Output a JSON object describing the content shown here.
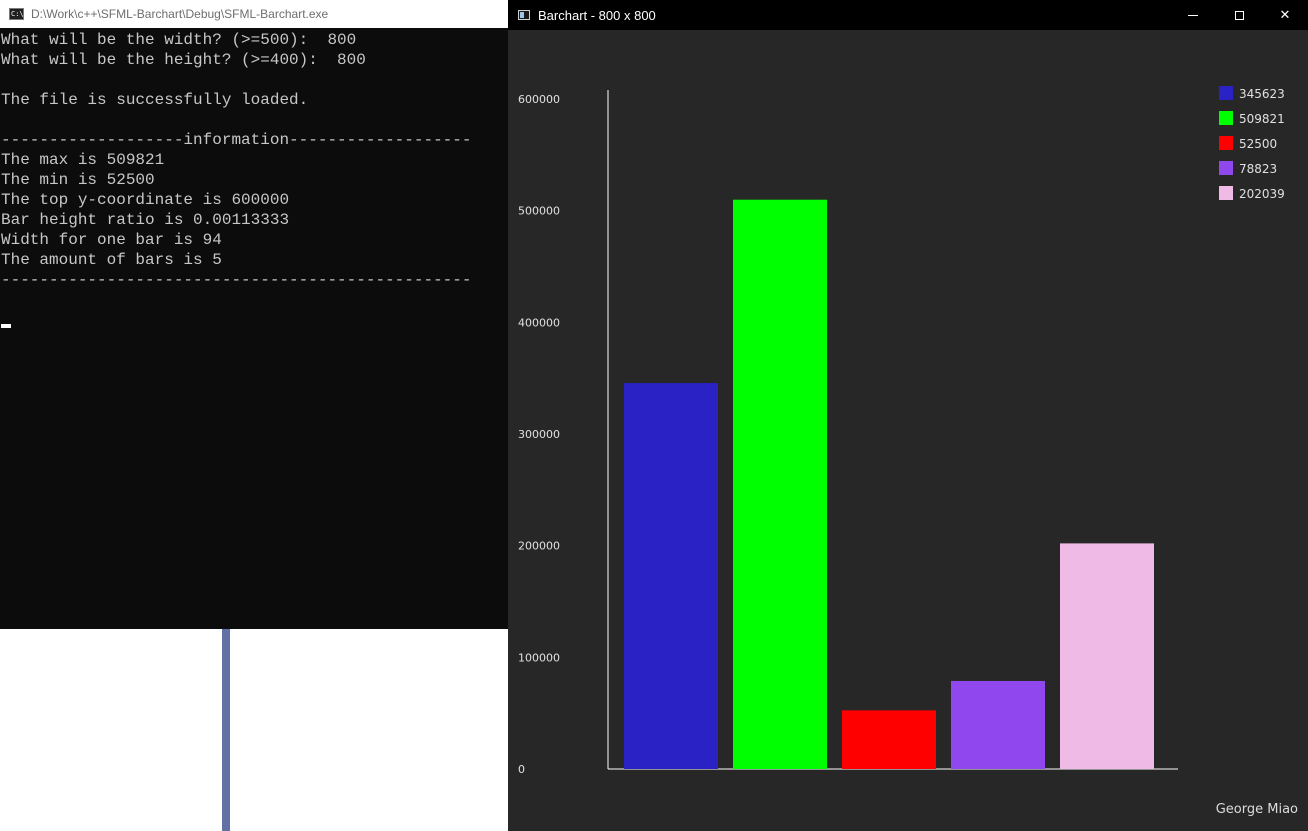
{
  "console": {
    "title": "D:\\Work\\c++\\SFML-Barchart\\Debug\\SFML-Barchart.exe",
    "icon": "cmd-icon",
    "icon_text": "C:\\",
    "lines": [
      "What will be the width? (>=500):  800",
      "What will be the height? (>=400):  800",
      "",
      "The file is successfully loaded.",
      "",
      "-------------------information-------------------",
      "The max is 509821",
      "The min is 52500",
      "The top y-coordinate is 600000",
      "Bar height ratio is 0.00113333",
      "Width for one bar is 94",
      "The amount of bars is 5",
      "-------------------------------------------------"
    ]
  },
  "chart_window": {
    "title": "Barchart - 800 x 800",
    "icon": "app-window-icon",
    "buttons": {
      "minimize": "minimize-icon",
      "maximize": "maximize-icon",
      "close": "✕"
    },
    "footer": "George Miao"
  },
  "colors": {
    "console_bg": "#0c0c0c",
    "console_text": "#c7c7c7",
    "chart_bg": "#272727",
    "axis": "#ffffff"
  },
  "chart_data": {
    "type": "bar",
    "categories": [
      "345623",
      "509821",
      "52500",
      "78823",
      "202039"
    ],
    "values": [
      345623,
      509821,
      52500,
      78823,
      202039
    ],
    "colors": [
      "#2a22c4",
      "#00ff00",
      "#ff0000",
      "#9047ee",
      "#efbbe6"
    ],
    "ylim": [
      0,
      600000
    ],
    "yticks": [
      "0",
      "100000",
      "200000",
      "300000",
      "400000",
      "500000",
      "600000"
    ],
    "legend": [
      "345623",
      "509821",
      "52500",
      "78823",
      "202039"
    ],
    "legend_position": "top-right",
    "grid": false
  }
}
